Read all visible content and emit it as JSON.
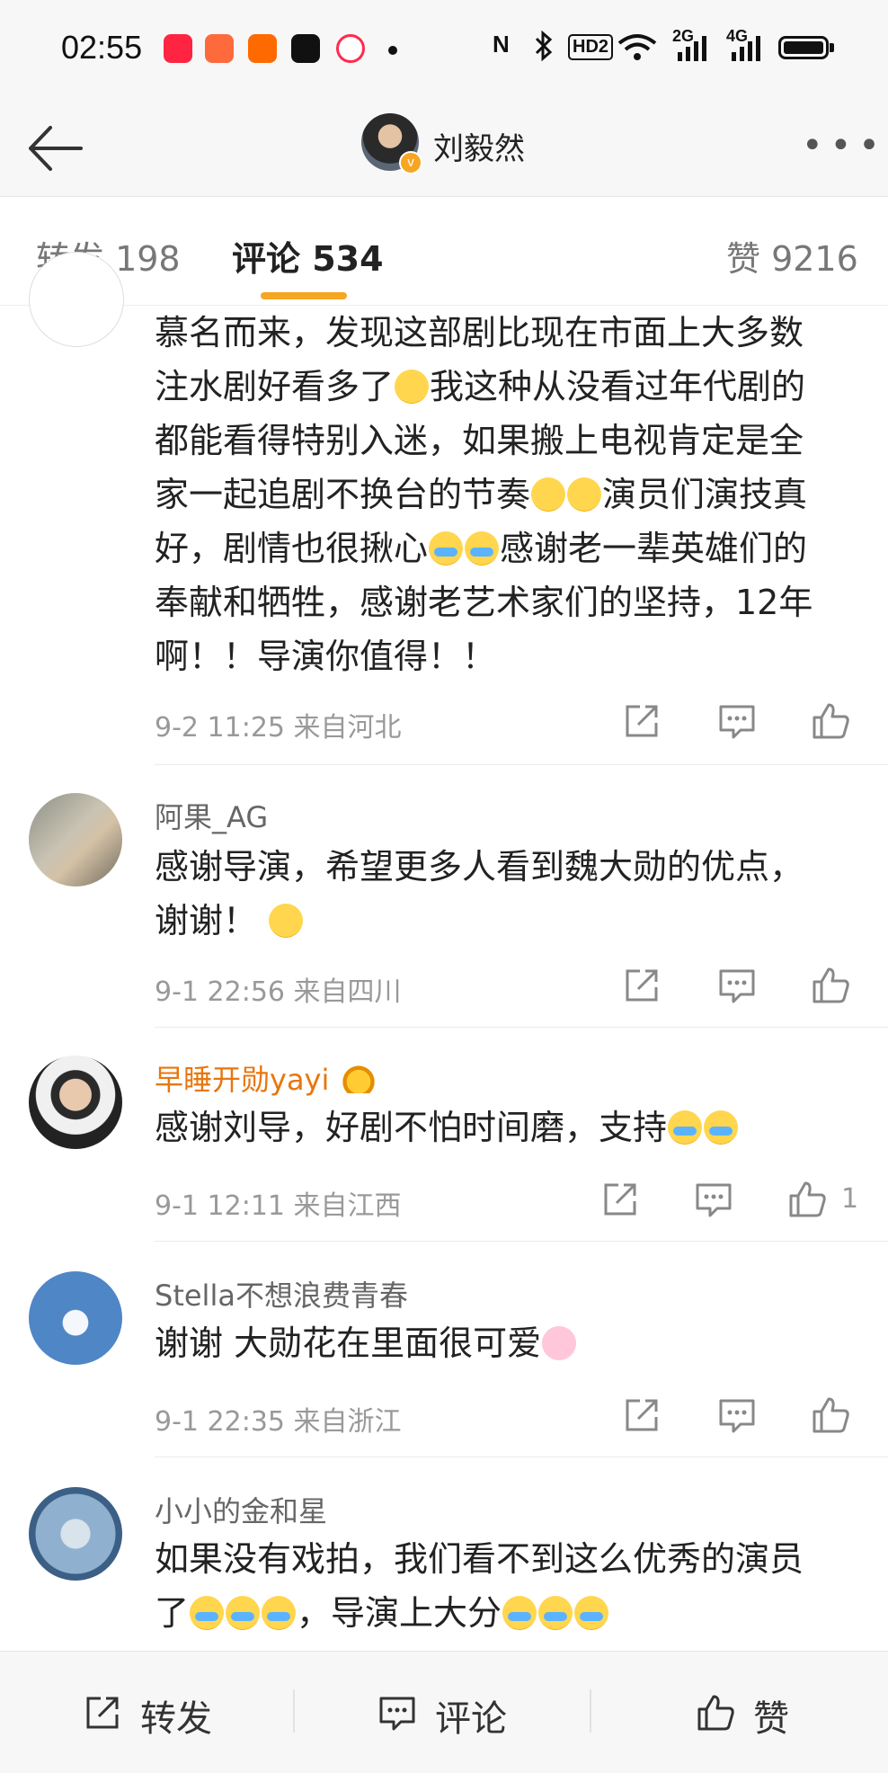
{
  "status": {
    "time": "02:55",
    "icons": [
      "xiaohongshu-icon",
      "camera-app-icon",
      "taobao-icon",
      "tiktok-icon",
      "video-app-icon"
    ],
    "nfc": "N",
    "bluetooth": "bluetooth-icon",
    "hd": "HD2",
    "signal1": "2G",
    "signal2": "4G"
  },
  "header": {
    "title": "刘毅然"
  },
  "tabs": [
    {
      "label": "转发 198"
    },
    {
      "label": "评论 534"
    },
    {
      "label": "赞 9216"
    }
  ],
  "comments": [
    {
      "name": "",
      "lines": [
        "慕名而来，发现这部剧比现在市面上大多数",
        "注水剧好看多了",
        "我这种从没看过年代剧的",
        "都能看得特别入迷，如果搬上电视肯定是全",
        "家一起追剧不换台的节奏",
        "演员们演技真",
        "好，剧情也很揪心",
        "感谢老一辈英雄们的",
        "奉献和牺牲，感谢老艺术家们的坚持，12年",
        "啊！！导演你值得！！"
      ],
      "meta": "9-2 11:25  来自河北",
      "likes": ""
    },
    {
      "name": "阿果_AG",
      "text1": "感谢导演，希望更多人看到魏大勋的优点，",
      "text2": "谢谢！",
      "meta": "9-1 22:56  来自四川",
      "likes": ""
    },
    {
      "name": "早睡开勋yayi",
      "text1": "感谢刘导，好剧不怕时间磨，支持",
      "meta": "9-1 12:11  来自江西",
      "likes": "1"
    },
    {
      "name": "Stella不想浪费青春",
      "text1": "谢谢 大勋花在里面很可爱",
      "meta": "9-1 22:35  来自浙江",
      "likes": ""
    },
    {
      "name": "小小的金和星",
      "text1": "如果没有戏拍，我们看不到这么优秀的演员",
      "text2a": "了",
      "text2b": "，导演上大分"
    }
  ],
  "bottom": {
    "repost": "转发",
    "comment": "评论",
    "like": "赞"
  },
  "colors": {
    "accent": "#f5a623",
    "vip_name": "#e8760d",
    "meta": "#999999"
  }
}
